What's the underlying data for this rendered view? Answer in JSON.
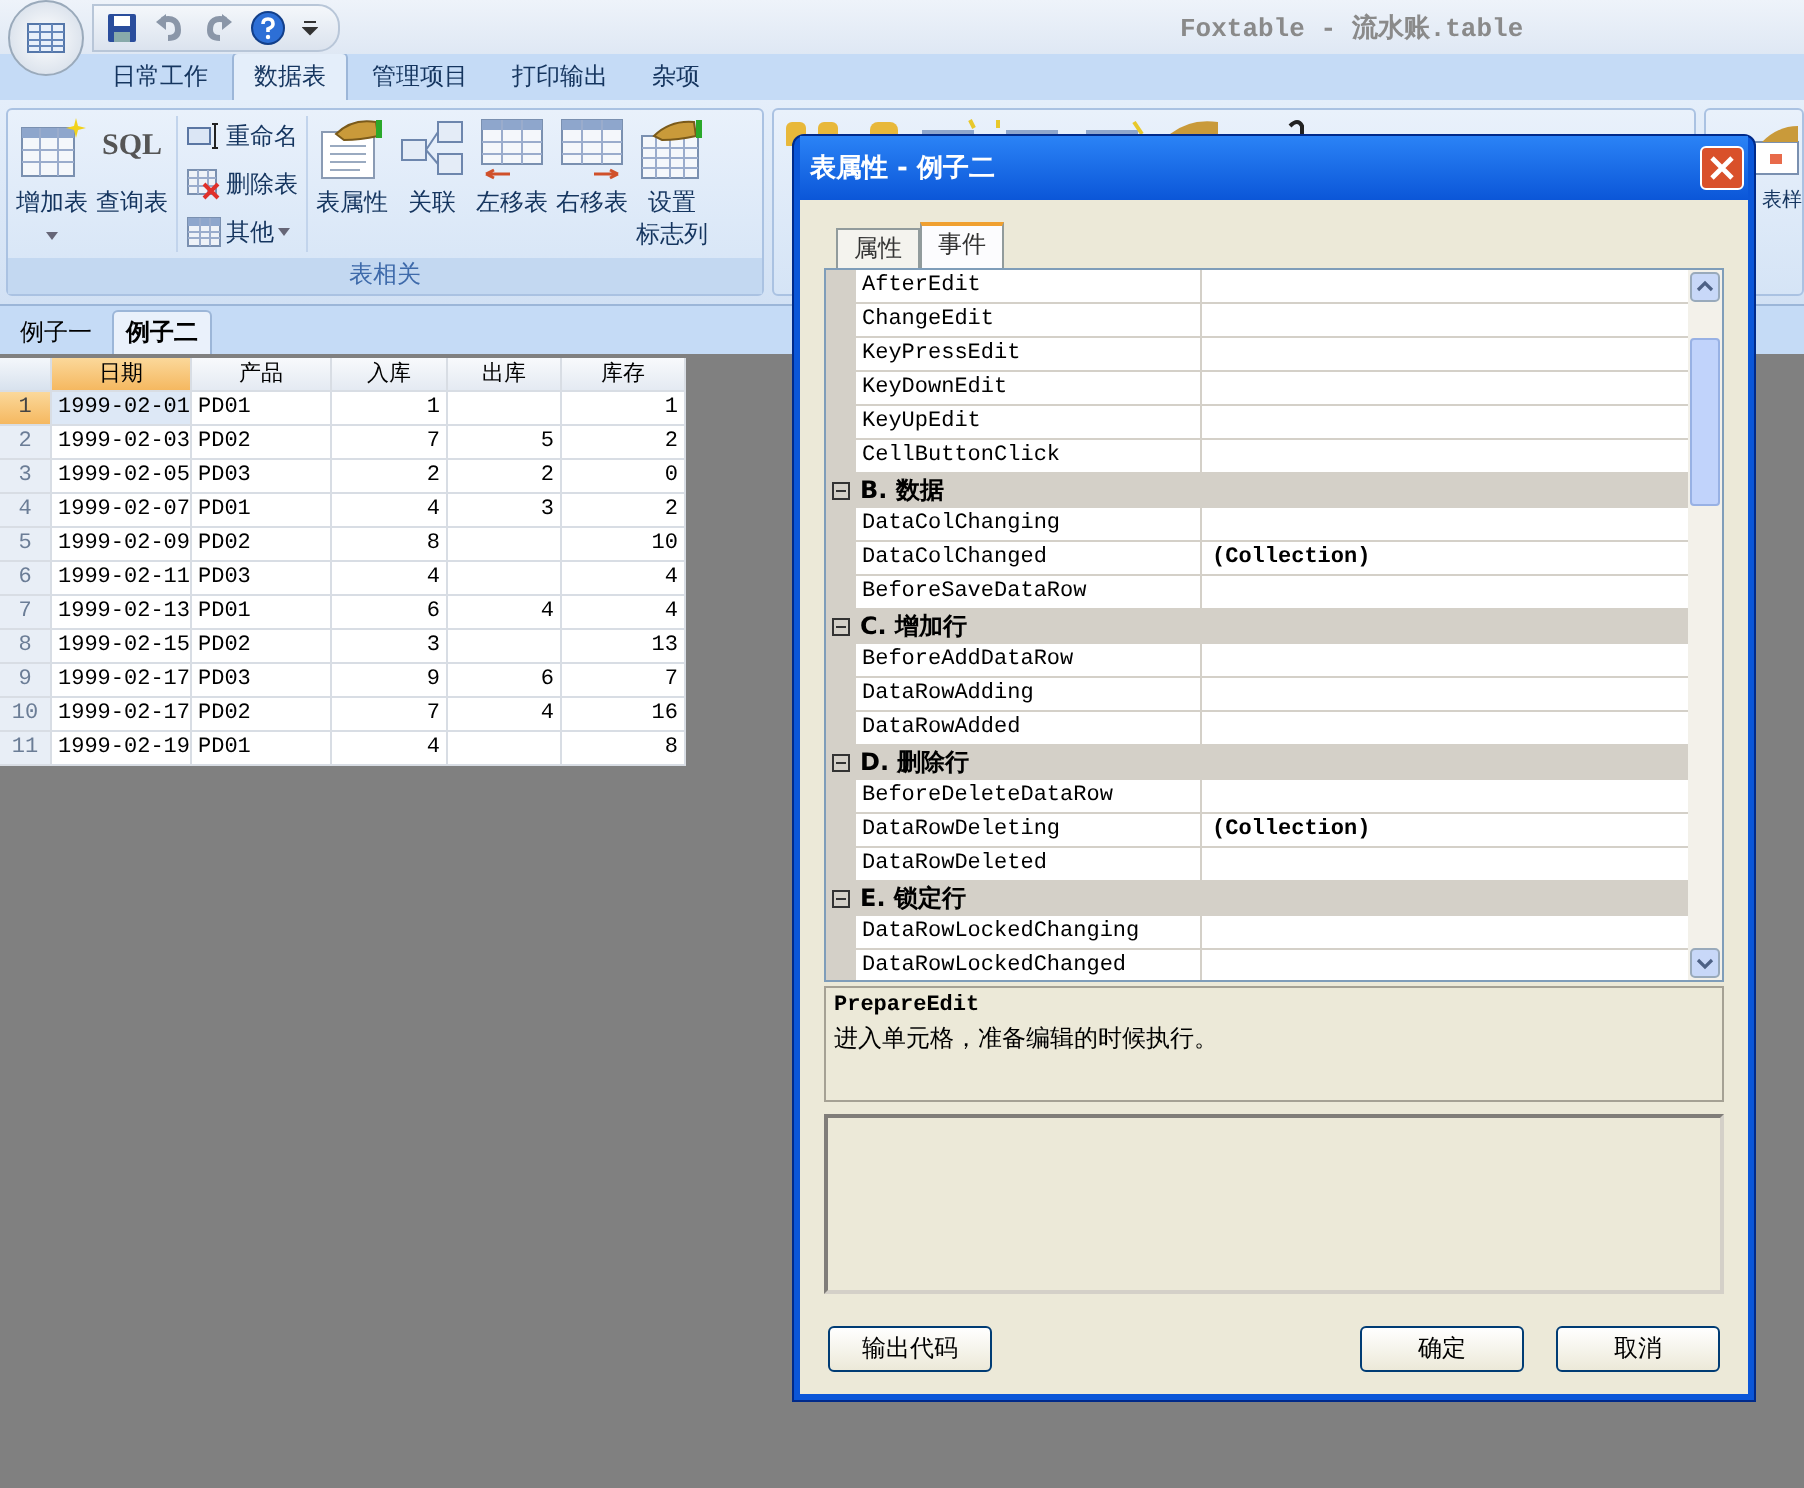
{
  "app": {
    "title": "Foxtable - 流水账.table"
  },
  "ribbon": {
    "tabs": [
      {
        "label": "日常工作",
        "selected": false
      },
      {
        "label": "数据表",
        "selected": true
      },
      {
        "label": "管理项目",
        "selected": false
      },
      {
        "label": "打印输出",
        "selected": false
      },
      {
        "label": "杂项",
        "selected": false
      }
    ],
    "group": {
      "label": "表相关",
      "items": [
        {
          "kind": "large",
          "lines": [
            "增加表"
          ],
          "dropdown": true
        },
        {
          "kind": "large",
          "icon_text": "SQL",
          "lines": [
            "查询表"
          ],
          "dropdown": false
        },
        {
          "kind": "small",
          "label": "重命名",
          "dropdown": false
        },
        {
          "kind": "small",
          "label": "删除表",
          "dropdown": false
        },
        {
          "kind": "small",
          "label": "其他",
          "dropdown": true
        },
        {
          "kind": "large",
          "lines": [
            "表属性"
          ],
          "dropdown": false
        },
        {
          "kind": "large",
          "lines": [
            "关联"
          ],
          "dropdown": false
        },
        {
          "kind": "large",
          "lines": [
            "左移表"
          ],
          "dropdown": false
        },
        {
          "kind": "large",
          "lines": [
            "右移表"
          ],
          "dropdown": false
        },
        {
          "kind": "large",
          "lines": [
            "设置",
            "标志列"
          ],
          "dropdown": false
        }
      ]
    },
    "cut_item": "表样"
  },
  "sheet_tabs": [
    {
      "label": "例子一",
      "selected": false
    },
    {
      "label": "例子二",
      "selected": true
    }
  ],
  "table": {
    "columns": [
      {
        "label": "日期",
        "kind": "text",
        "selected": true
      },
      {
        "label": "产品",
        "kind": "text",
        "selected": false
      },
      {
        "label": "入库",
        "kind": "number",
        "selected": false
      },
      {
        "label": "出库",
        "kind": "number",
        "selected": false
      },
      {
        "label": "库存",
        "kind": "number",
        "selected": false
      }
    ],
    "rows": [
      {
        "num": "1",
        "selected": true,
        "cells": [
          "1999-02-01",
          "PD01",
          "1",
          "",
          "1"
        ]
      },
      {
        "num": "2",
        "selected": false,
        "cells": [
          "1999-02-03",
          "PD02",
          "7",
          "5",
          "2"
        ]
      },
      {
        "num": "3",
        "selected": false,
        "cells": [
          "1999-02-05",
          "PD03",
          "2",
          "2",
          "0"
        ]
      },
      {
        "num": "4",
        "selected": false,
        "cells": [
          "1999-02-07",
          "PD01",
          "4",
          "3",
          "2"
        ]
      },
      {
        "num": "5",
        "selected": false,
        "cells": [
          "1999-02-09",
          "PD02",
          "8",
          "",
          "10"
        ]
      },
      {
        "num": "6",
        "selected": false,
        "cells": [
          "1999-02-11",
          "PD03",
          "4",
          "",
          "4"
        ]
      },
      {
        "num": "7",
        "selected": false,
        "cells": [
          "1999-02-13",
          "PD01",
          "6",
          "4",
          "4"
        ]
      },
      {
        "num": "8",
        "selected": false,
        "cells": [
          "1999-02-15",
          "PD02",
          "3",
          "",
          "13"
        ]
      },
      {
        "num": "9",
        "selected": false,
        "cells": [
          "1999-02-17",
          "PD03",
          "9",
          "6",
          "7"
        ]
      },
      {
        "num": "10",
        "selected": false,
        "cells": [
          "1999-02-17",
          "PD02",
          "7",
          "4",
          "16"
        ]
      },
      {
        "num": "11",
        "selected": false,
        "cells": [
          "1999-02-19",
          "PD01",
          "4",
          "",
          "8"
        ]
      }
    ]
  },
  "dialog": {
    "title": "表属性 - 例子二",
    "tabs": [
      {
        "label": "属性",
        "selected": false
      },
      {
        "label": "事件",
        "selected": true
      }
    ],
    "properties": [
      {
        "kind": "property",
        "name": "AfterEdit"
      },
      {
        "kind": "property",
        "name": "ChangeEdit"
      },
      {
        "kind": "property",
        "name": "KeyPressEdit"
      },
      {
        "kind": "property",
        "name": "KeyDownEdit"
      },
      {
        "kind": "property",
        "name": "KeyUpEdit"
      },
      {
        "kind": "property",
        "name": "CellButtonClick"
      },
      {
        "kind": "category",
        "name": "B. 数据",
        "expanded": true
      },
      {
        "kind": "property",
        "name": "DataColChanging"
      },
      {
        "kind": "property",
        "name": "DataColChanged",
        "value": "(Collection)"
      },
      {
        "kind": "property",
        "name": "BeforeSaveDataRow"
      },
      {
        "kind": "category",
        "name": "C. 增加行",
        "expanded": true
      },
      {
        "kind": "property",
        "name": "BeforeAddDataRow"
      },
      {
        "kind": "property",
        "name": "DataRowAdding"
      },
      {
        "kind": "property",
        "name": "DataRowAdded"
      },
      {
        "kind": "category",
        "name": "D. 删除行",
        "expanded": true
      },
      {
        "kind": "property",
        "name": "BeforeDeleteDataRow"
      },
      {
        "kind": "property",
        "name": "DataRowDeleting",
        "value": "(Collection)"
      },
      {
        "kind": "property",
        "name": "DataRowDeleted"
      },
      {
        "kind": "category",
        "name": "E. 锁定行",
        "expanded": true
      },
      {
        "kind": "property",
        "name": "DataRowLockedChanging"
      },
      {
        "kind": "property",
        "name": "DataRowLockedChanged"
      }
    ],
    "description": {
      "title": "PrepareEdit",
      "text": "进入单元格，准备编辑的时候执行。"
    },
    "buttons": [
      {
        "label": "输出代码",
        "kind": "left"
      },
      {
        "label": "确定",
        "kind": "right"
      },
      {
        "label": "取消",
        "kind": "right"
      }
    ]
  }
}
